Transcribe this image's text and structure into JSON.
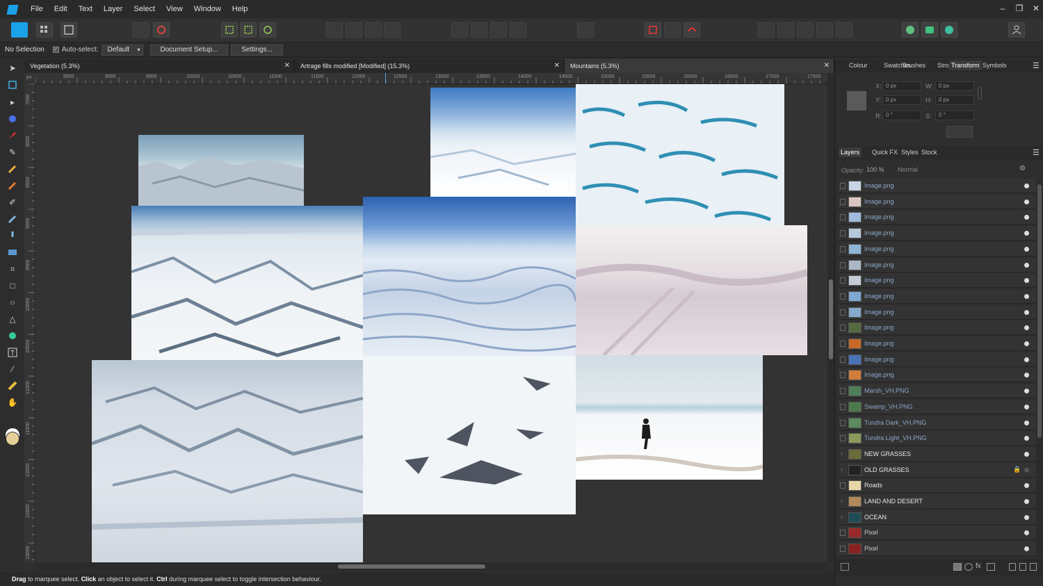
{
  "menu": {
    "items": [
      "File",
      "Edit",
      "Text",
      "Layer",
      "Select",
      "View",
      "Window",
      "Help"
    ],
    "window_controls": {
      "minimize": "–",
      "restore": "❐",
      "close": "✕"
    }
  },
  "context_bar": {
    "selection": "No Selection",
    "autoselect_label": "Auto-select:",
    "autoselect_value": "Default",
    "document_setup": "Document Setup...",
    "settings": "Settings..."
  },
  "tabs": [
    {
      "label": "Vegetation (5.3%)",
      "close": "✕"
    },
    {
      "label": "Artrage fills modified [Modified] (15.3%)",
      "close": "✕"
    },
    {
      "label": "Mountains (5.3%)",
      "close": "✕"
    }
  ],
  "ruler": {
    "unit": "px",
    "h_ticks": [
      "8500",
      "9000",
      "9500",
      "10000",
      "10500",
      "11000",
      "11500",
      "12000",
      "12500",
      "13000",
      "13500",
      "14000",
      "14500",
      "15000",
      "15500",
      "16000",
      "16500",
      "17000",
      "17500"
    ],
    "v_ticks": [
      "7500",
      "8000",
      "8500",
      "9000",
      "9500",
      "10000",
      "10500",
      "11000",
      "11500",
      "12000",
      "12500",
      "13000"
    ]
  },
  "status": {
    "t1": "Drag",
    "t2": " to marquee select. ",
    "t3": "Click",
    "t4": " an object to select it. ",
    "t5": "Ctrl",
    "t6": " during marquee select to toggle intersection behaviour."
  },
  "top_panel": {
    "tabs": [
      "Colour",
      "Swatches",
      "Brushes",
      "Stroke",
      "Transform",
      "Symbols"
    ],
    "active_tab": "Transform",
    "x_label": "X:",
    "x_value": "0 px",
    "y_label": "Y:",
    "y_value": "0 px",
    "w_label": "W:",
    "w_value": "0 px",
    "h_label": "H:",
    "h_value": "0 px",
    "r_label": "R:",
    "r_value": "0 °",
    "s_label": "S:",
    "s_value": "0 °"
  },
  "layers_panel": {
    "tabs": [
      "Layers",
      "Quick FX",
      "Styles",
      "Stock"
    ],
    "active_tab": "Layers",
    "opacity_label": "Opacity:",
    "opacity_value": "100 %",
    "blend_mode": "Normal",
    "layers": [
      {
        "name": "Image.png",
        "thumb": "#c8d4e4"
      },
      {
        "name": "Image.png",
        "thumb": "#d9c6c0"
      },
      {
        "name": "Image.png",
        "thumb": "#9fbcdc"
      },
      {
        "name": "Image.png",
        "thumb": "#b5c8da"
      },
      {
        "name": "Image.png",
        "thumb": "#8fb6d6"
      },
      {
        "name": "Image.png",
        "thumb": "#aab7c6"
      },
      {
        "name": "Image.png",
        "thumb": "#c5ccd6"
      },
      {
        "name": "Image.png",
        "thumb": "#7fa8d4"
      },
      {
        "name": "Image.png",
        "thumb": "#86a9cc"
      },
      {
        "name": "Image.png",
        "thumb": "#556b3f"
      },
      {
        "name": "Image.png",
        "thumb": "#c8692a"
      },
      {
        "name": "Image.png",
        "thumb": "#4a74b8"
      },
      {
        "name": "Image.png",
        "thumb": "#d07d3a"
      },
      {
        "name": "Marsh_VH.PNG",
        "thumb": "#4e7e58"
      },
      {
        "name": "Swamp_VH.PNG",
        "thumb": "#4d7a4a"
      },
      {
        "name": "Tundra Dark_VH.PNG",
        "thumb": "#5c8a5e"
      },
      {
        "name": "Tundra Light_VH.PNG",
        "thumb": "#8a9a5a"
      },
      {
        "name": "NEW GRASSES",
        "thumb": "#6a6a3a"
      },
      {
        "name": "OLD GRASSES",
        "thumb": "#222222"
      },
      {
        "name": "Roads",
        "thumb": "#e8d6a8"
      },
      {
        "name": "LAND AND DESERT",
        "thumb": "#b08a5a"
      },
      {
        "name": "OCEAN",
        "thumb": "#1f4d55"
      },
      {
        "name": "Pixel",
        "thumb": "#9a2a2a"
      },
      {
        "name": "Pixel",
        "thumb": "#8a2020"
      }
    ]
  }
}
